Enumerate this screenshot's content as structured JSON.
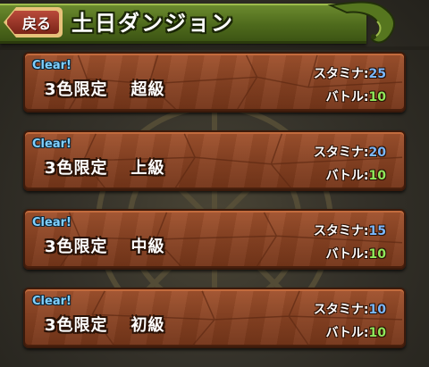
{
  "header": {
    "back_label": "戻る",
    "title": "土日ダンジョン"
  },
  "dungeons": [
    {
      "clear": "Clear!",
      "name": "3色限定",
      "difficulty": "超級",
      "stamina_label": "スタミナ:",
      "stamina": "25",
      "battle_label": "バトル:",
      "battle": "10"
    },
    {
      "clear": "Clear!",
      "name": "3色限定",
      "difficulty": "上級",
      "stamina_label": "スタミナ:",
      "stamina": "20",
      "battle_label": "バトル:",
      "battle": "10"
    },
    {
      "clear": "Clear!",
      "name": "3色限定",
      "difficulty": "中級",
      "stamina_label": "スタミナ:",
      "stamina": "15",
      "battle_label": "バトル:",
      "battle": "10"
    },
    {
      "clear": "Clear!",
      "name": "3色限定",
      "difficulty": "初級",
      "stamina_label": "スタミナ:",
      "stamina": "10",
      "battle_label": "バトル:",
      "battle": "10"
    }
  ],
  "colors": {
    "header_green": "#4e6a1c",
    "panel_brown": "#8a4424",
    "clear_blue": "#7fd0ff",
    "stamina_blue": "#7ab8ff",
    "battle_green": "#8fe85a"
  }
}
